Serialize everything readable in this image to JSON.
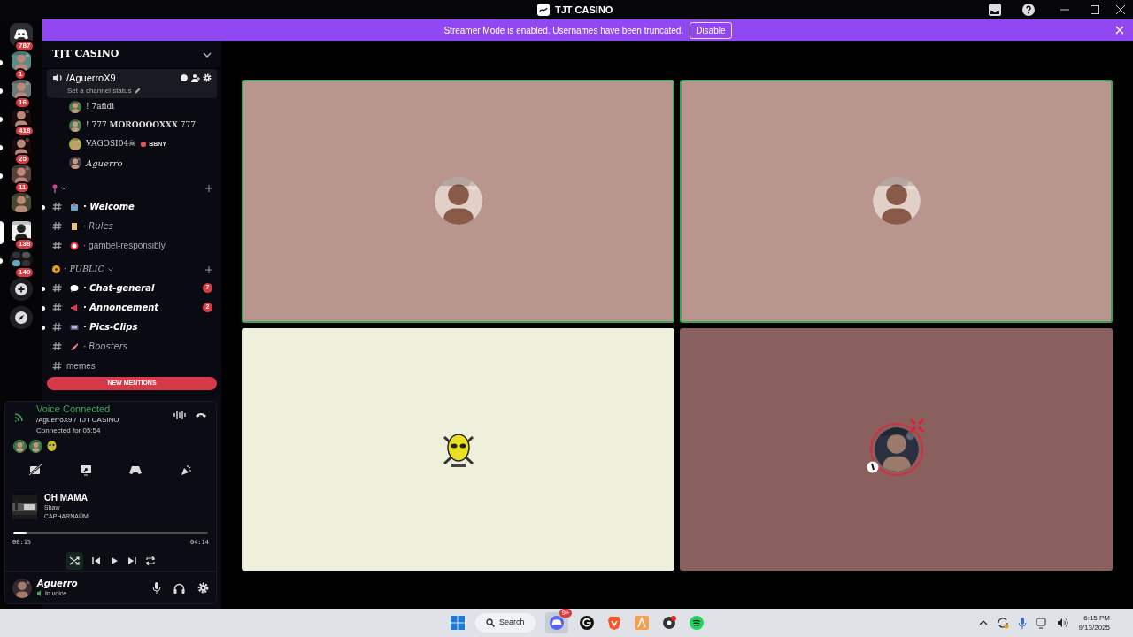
{
  "window": {
    "title": "TJT CASINO"
  },
  "banner": {
    "text": "Streamer Mode is enabled. Usernames have been truncated.",
    "button": "Disable"
  },
  "servers": [
    {
      "kind": "home",
      "badge": "787"
    },
    {
      "kind": "server",
      "badge": "1",
      "unread": true,
      "selected": false
    },
    {
      "kind": "server",
      "badge": "16",
      "unread": true,
      "selected": false
    },
    {
      "kind": "server",
      "badge": "418",
      "unread": true,
      "selected": false
    },
    {
      "kind": "server",
      "badge": "25",
      "unread": true,
      "selected": false
    },
    {
      "kind": "server",
      "badge": "11",
      "unread": true,
      "selected": false
    },
    {
      "kind": "server",
      "unread": false,
      "selected": false
    },
    {
      "kind": "server",
      "badge": "138",
      "unread": false,
      "selected": true
    },
    {
      "kind": "folder",
      "badge": "149",
      "unread": true,
      "selected": false
    },
    {
      "kind": "add"
    },
    {
      "kind": "discover"
    }
  ],
  "sidebar": {
    "server_name": "TJT CASINO",
    "voice_channel": {
      "name": "/AguerroX9",
      "status": "Set a channel status",
      "members": [
        {
          "name": "! 7afidi",
          "italic": false
        },
        {
          "name": "! 777 **MOROOOOXXX** 777",
          "italic": false
        },
        {
          "name": "VAGOSI04☠",
          "tag": "BBNY",
          "italic": false
        },
        {
          "name": "Aguerro",
          "italic": true
        }
      ]
    },
    "categories": [
      {
        "channels": [
          {
            "name": "· Welcome",
            "unread": true,
            "italic": true
          },
          {
            "name": "· Rules",
            "unread": false,
            "italic": true
          },
          {
            "name": "· gambel-responsibly",
            "unread": false,
            "italic": false
          }
        ]
      },
      {
        "name": "· PUBLIC",
        "channels": [
          {
            "name": "· Chat-general",
            "unread": true,
            "italic": true,
            "badge": "7"
          },
          {
            "name": "· Annoncement",
            "unread": true,
            "italic": true,
            "badge": "2"
          },
          {
            "name": "· Pics-Clips",
            "unread": true,
            "italic": true
          },
          {
            "name": "· Boosters",
            "unread": false,
            "italic": true
          },
          {
            "name": "memes",
            "unread": false,
            "italic": false
          }
        ]
      }
    ],
    "new_mentions": "NEW MENTIONS"
  },
  "voice_panel": {
    "status": "Voice Connected",
    "channel": "/AguerroX9 / TJT CASINO",
    "duration": "Connected for 05:54",
    "music": {
      "title": "OH MAMA",
      "artist": "Shaw",
      "album": "CAPHARNAÜM",
      "elapsed": "00:15",
      "total": "04:14",
      "level": 0.07,
      "shuffle": true
    },
    "user": {
      "name": "Aguerro",
      "status": "In voice"
    }
  },
  "tiles": [
    {
      "color": "#b8968e",
      "speaking": true,
      "kind": "avatar"
    },
    {
      "color": "#b8968e",
      "speaking": true,
      "kind": "avatar"
    },
    {
      "color": "#eef0dc",
      "speaking": false,
      "kind": "mask"
    },
    {
      "color": "#8a605e",
      "speaking": false,
      "kind": "ringed"
    }
  ],
  "taskbar": {
    "search": "Search",
    "discord_badge": "9+",
    "time": "6:15 PM",
    "date": "9/13/2025"
  }
}
